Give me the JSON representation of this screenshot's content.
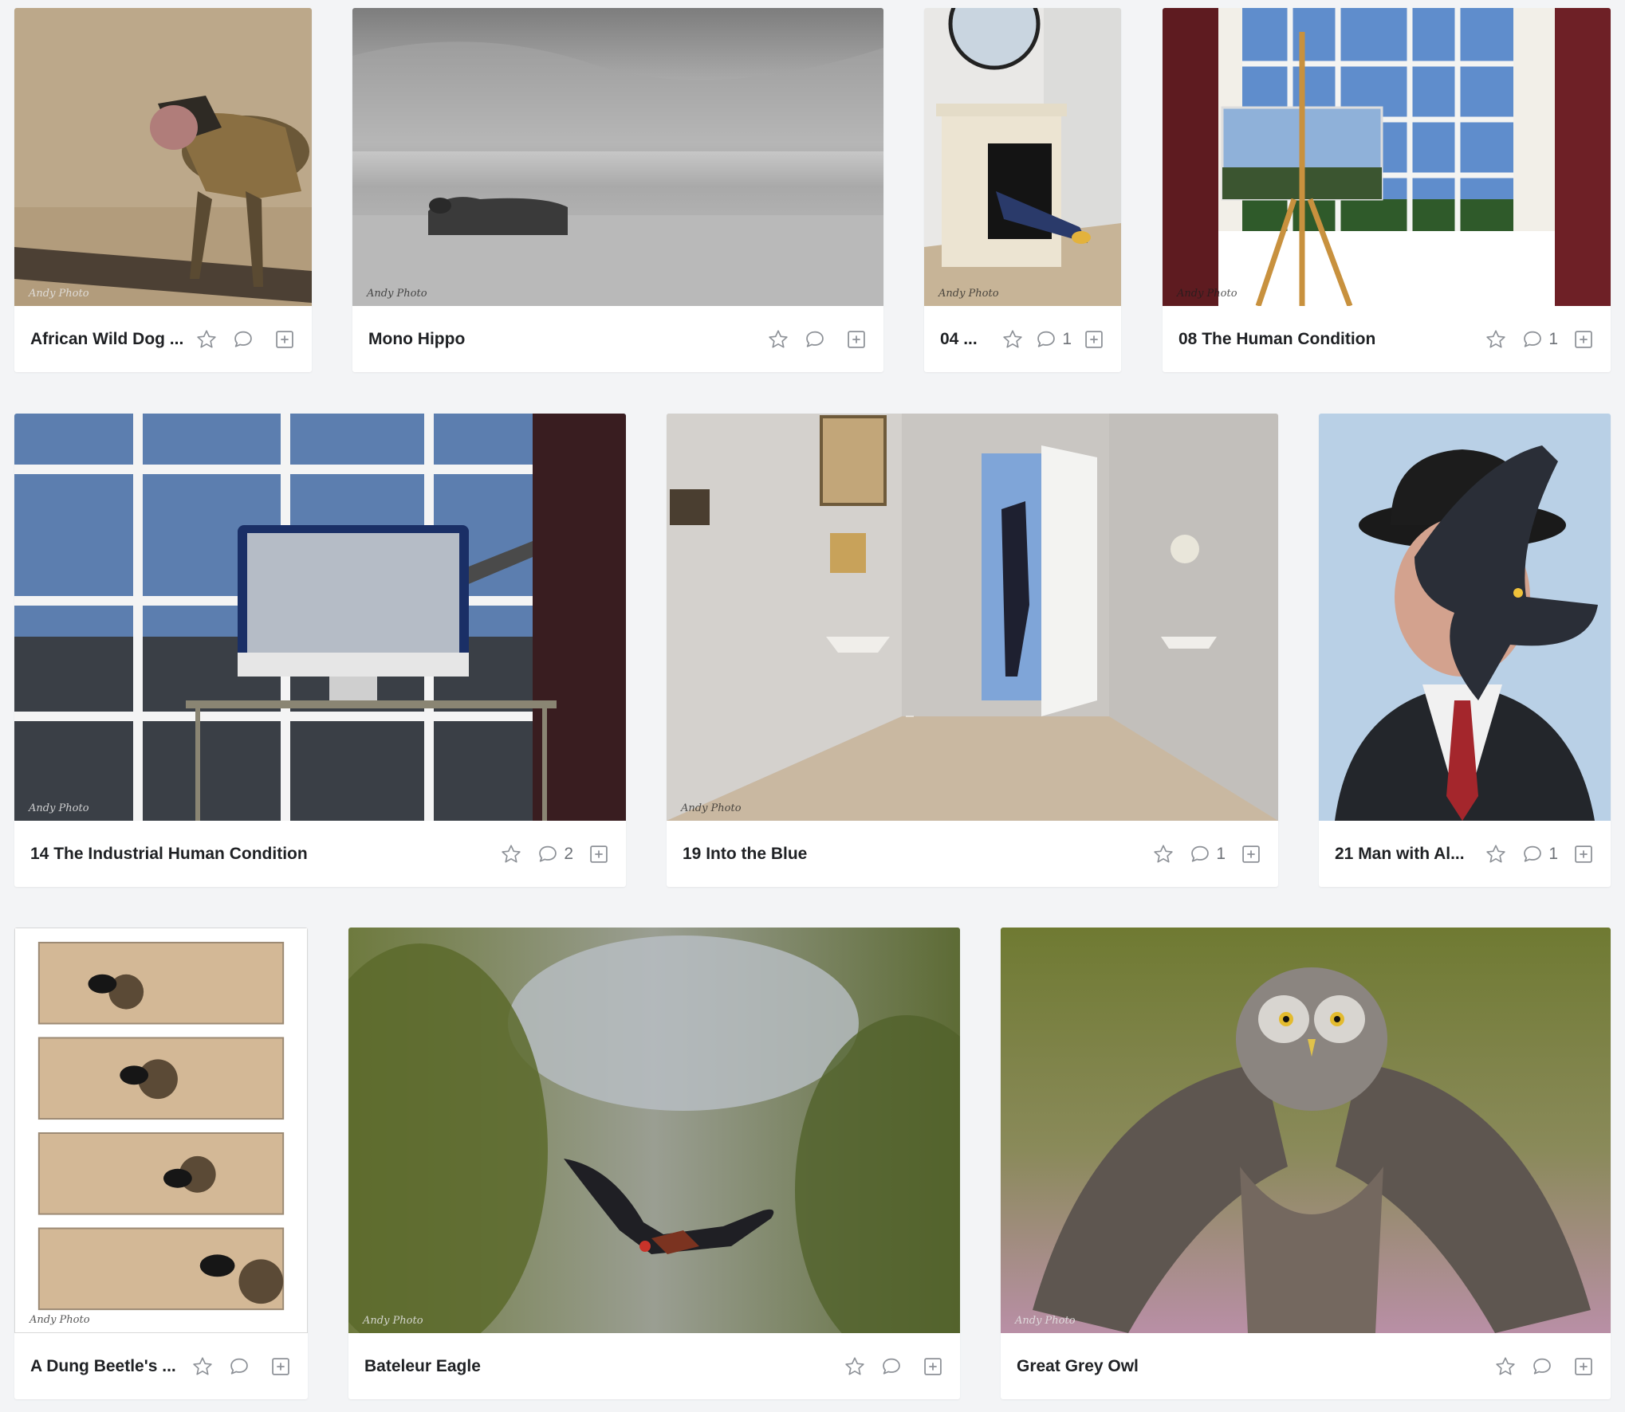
{
  "colors": {
    "page_bg": "#f3f4f6",
    "card_bg": "#ffffff",
    "icon": "#8d9197",
    "title": "#1f2124"
  },
  "icons": {
    "favorite": "star-outline-icon",
    "comment": "speech-bubble-icon",
    "add": "plus-square-icon"
  },
  "photos": [
    {
      "title": "African Wild Dog ...",
      "comments": ""
    },
    {
      "title": "Mono Hippo",
      "comments": ""
    },
    {
      "title": "04 ...",
      "comments": "1"
    },
    {
      "title": "08 The Human Condition",
      "comments": "1"
    },
    {
      "title": "14 The Industrial Human Condition",
      "comments": "2"
    },
    {
      "title": "19 Into the Blue",
      "comments": "1"
    },
    {
      "title": "21 Man with Al...",
      "comments": "1"
    },
    {
      "title": "A Dung Beetle's ...",
      "comments": ""
    },
    {
      "title": "Bateleur Eagle",
      "comments": ""
    },
    {
      "title": "Great Grey Owl",
      "comments": ""
    }
  ]
}
